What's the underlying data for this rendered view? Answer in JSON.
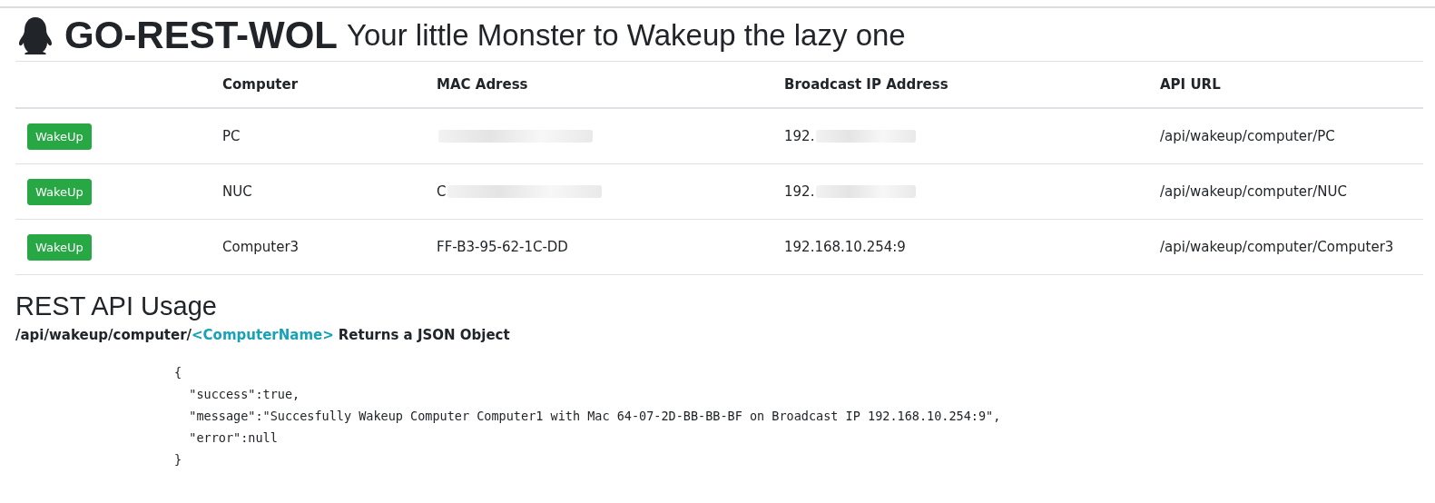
{
  "header": {
    "title": "GO-REST-WOL",
    "subtitle": "Your little Monster to Wakeup the lazy one"
  },
  "table": {
    "columns": [
      "Computer",
      "MAC Adress",
      "Broadcast IP Address",
      "API URL"
    ],
    "rows": [
      {
        "button": "WakeUp",
        "computer": "PC",
        "mac": "",
        "mac_redacted": true,
        "ip": "192.",
        "ip_redacted": true,
        "url": "/api/wakeup/computer/PC"
      },
      {
        "button": "WakeUp",
        "computer": "NUC",
        "mac": "C",
        "mac_redacted": true,
        "ip": "192.",
        "ip_redacted": true,
        "url": "/api/wakeup/computer/NUC"
      },
      {
        "button": "WakeUp",
        "computer": "Computer3",
        "mac": "FF-B3-95-62-1C-DD",
        "mac_redacted": false,
        "ip": "192.168.10.254:9",
        "ip_redacted": false,
        "url": "/api/wakeup/computer/Computer3"
      }
    ]
  },
  "usage": {
    "heading": "REST API Usage",
    "path": "/api/wakeup/computer/",
    "param": "<ComputerName>",
    "returns": "Returns a JSON Object",
    "code": [
      "{",
      "  \"success\":true,",
      "  \"message\":\"Succesfully Wakeup Computer Computer1 with Mac 64-07-2D-BB-BB-BF on Broadcast IP 192.168.10.254:9\",",
      "  \"error\":null",
      "}"
    ]
  }
}
